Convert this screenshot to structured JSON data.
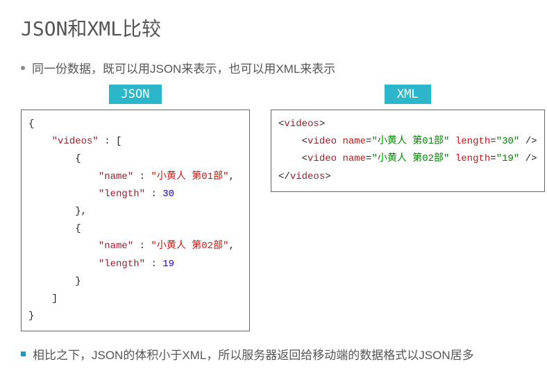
{
  "title": "JSON和XML比较",
  "bullet1": "同一份数据，既可以用JSON来表示，也可以用XML来表示",
  "json_tag": "JSON",
  "xml_tag": "XML",
  "json_code": {
    "root_key": "\"videos\"",
    "item1_name_key": "\"name\"",
    "item1_name_val": "\"小黄人 第01部\"",
    "item1_len_key": "\"length\"",
    "item1_len_val": "30",
    "item2_name_key": "\"name\"",
    "item2_name_val": "\"小黄人 第02部\"",
    "item2_len_key": "\"length\"",
    "item2_len_val": "19"
  },
  "xml_code": {
    "open_tag": "videos",
    "row1": {
      "tag": "video",
      "name_attr": "name",
      "name_val": "\"小黄人 第01部\"",
      "len_attr": "length",
      "len_val": "\"30\""
    },
    "row2": {
      "tag": "video",
      "name_attr": "name",
      "name_val": "\"小黄人 第02部\"",
      "len_attr": "length",
      "len_val": "\"19\""
    },
    "close_tag": "videos"
  },
  "bullet2": "相比之下，JSON的体积小于XML，所以服务器返回给移动端的数据格式以JSON居多"
}
